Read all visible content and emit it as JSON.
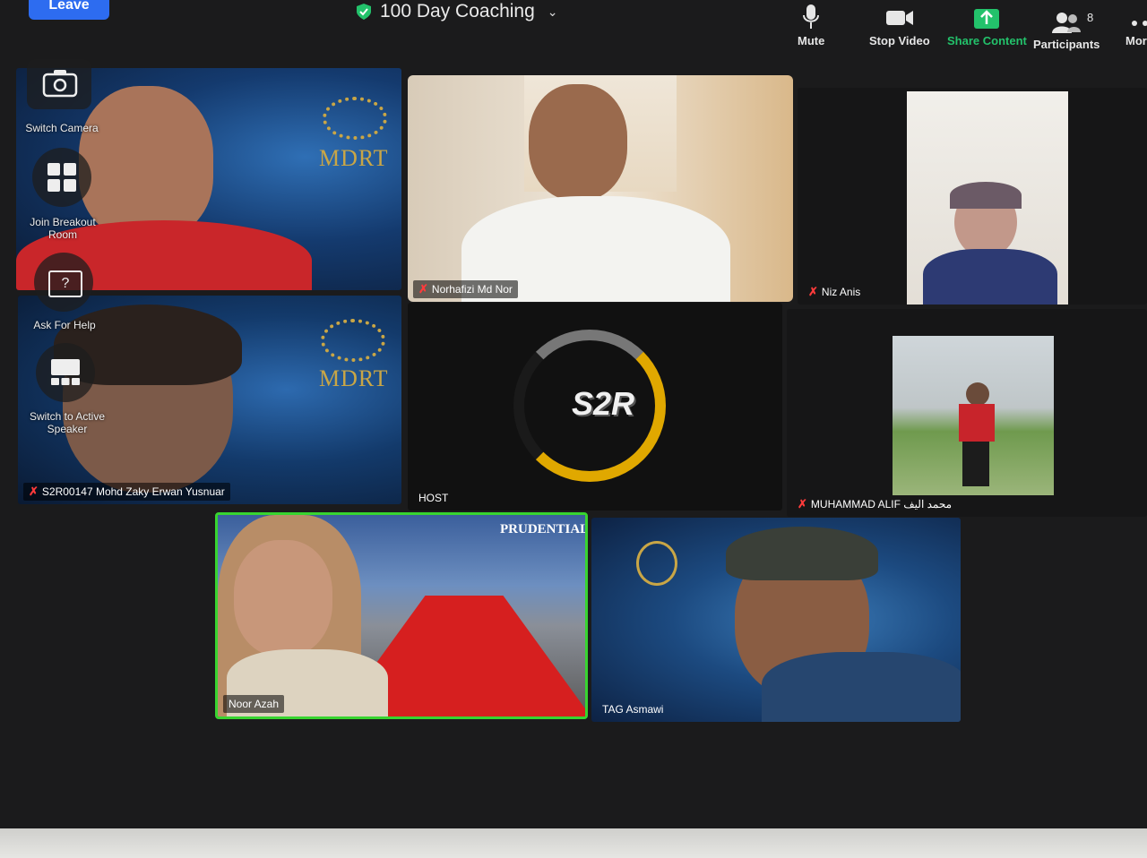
{
  "toolbar": {
    "leave": "Leave",
    "title": "100 Day Coaching",
    "mute": "Mute",
    "stop_video": "Stop Video",
    "share_content": "Share Content",
    "participants": "Participants",
    "participants_count": "8",
    "more": "More"
  },
  "side_menu": {
    "switch_camera": "Switch Camera",
    "join_breakout": "Join Breakout Room",
    "ask_for_help": "Ask For Help",
    "help_glyph": "?",
    "switch_active_speaker": "Switch to Active Speaker"
  },
  "tiles": [
    {
      "name": "",
      "muted": false,
      "logo": "MDRT"
    },
    {
      "name": "Norhafizi Md Nor",
      "muted": true
    },
    {
      "name": "Niz Anis",
      "muted": true
    },
    {
      "name": "S2R00147 Mohd Zaky Erwan Yusnuar",
      "muted": true,
      "logo": "MDRT"
    },
    {
      "name": "HOST",
      "muted": false,
      "logo": "S2R"
    },
    {
      "name": "MUHAMMAD ALIF محمد اليف",
      "muted": true
    },
    {
      "name": "Noor Azah",
      "muted": false,
      "active_speaker": true,
      "logo": "PRUDENTIAL"
    },
    {
      "name": "TAG Asmawi",
      "muted": false
    }
  ],
  "colors": {
    "leave_button": "#2d6cf0",
    "share_green": "#23c26b",
    "active_speaker_border": "#38d430",
    "mic_off": "#ff3b3b",
    "mdrt_gold": "#c9a646"
  }
}
